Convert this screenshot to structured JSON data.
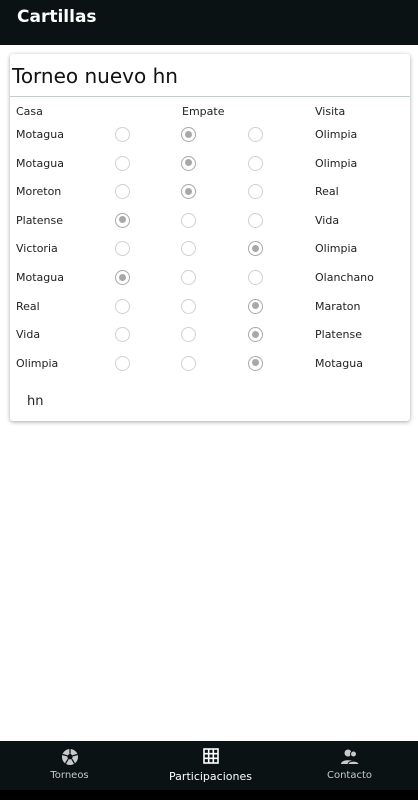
{
  "appbar": {
    "title": "Cartillas"
  },
  "card": {
    "title": "Torneo nuevo hn",
    "headers": {
      "home": "Casa",
      "draw": "Empate",
      "away": "Visita"
    },
    "matches": [
      {
        "home": "Motagua",
        "away": "Olimpia",
        "selected": "draw"
      },
      {
        "home": "Motagua",
        "away": "Olimpia",
        "selected": "draw"
      },
      {
        "home": "Moreton",
        "away": "Real",
        "selected": "draw"
      },
      {
        "home": "Platense",
        "away": "Vida",
        "selected": "home"
      },
      {
        "home": "Victoria",
        "away": "Olimpia",
        "selected": "away"
      },
      {
        "home": "Motagua",
        "away": "Olanchano",
        "selected": "home"
      },
      {
        "home": "Real",
        "away": "Maraton",
        "selected": "away"
      },
      {
        "home": "Vida",
        "away": "Platense",
        "selected": "away"
      },
      {
        "home": "Olimpia",
        "away": "Motagua",
        "selected": "away"
      }
    ],
    "footer": "hn"
  },
  "nav": {
    "items": [
      {
        "label": "Torneos",
        "icon": "soccer-ball-icon",
        "active": false
      },
      {
        "label": "Participaciones",
        "icon": "grid-icon",
        "active": true
      },
      {
        "label": "Contacto",
        "icon": "contacts-icon",
        "active": false
      }
    ]
  },
  "colors": {
    "bar": "#0a1214",
    "radio_checked": "#a8a8a8",
    "divider": "#b8d2cf"
  }
}
